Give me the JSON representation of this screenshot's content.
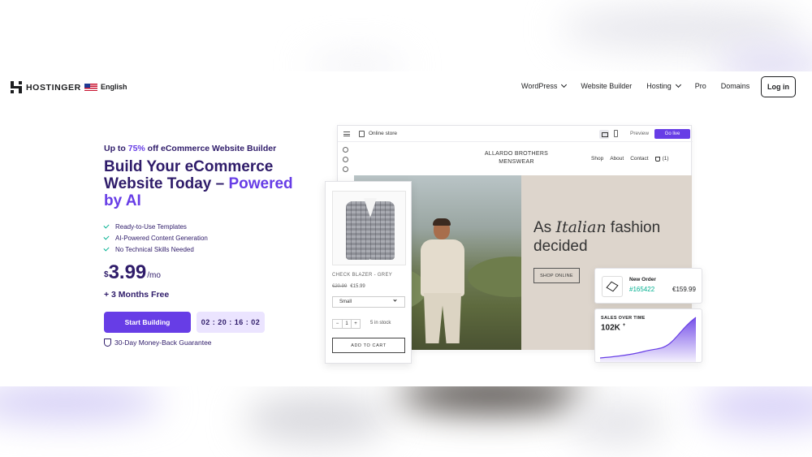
{
  "nav": {
    "logo": "HOSTINGER",
    "language": "English",
    "items": [
      {
        "label": "WordPress",
        "dropdown": true
      },
      {
        "label": "Website Builder",
        "dropdown": false
      },
      {
        "label": "Hosting",
        "dropdown": true
      },
      {
        "label": "Pro",
        "dropdown": false
      },
      {
        "label": "Domains",
        "dropdown": false
      }
    ],
    "login": "Log in"
  },
  "hero": {
    "eyebrow_prefix": "Up to ",
    "eyebrow_highlight": "75%",
    "eyebrow_suffix": " off eCommerce Website Builder",
    "headline_main": "Build Your eCommerce Website Today – ",
    "headline_highlight": "Powered by AI",
    "features": [
      "Ready-to-Use Templates",
      "AI-Powered Content Generation",
      "No Technical Skills Needed"
    ],
    "price_currency": "$",
    "price_amount": "3.99",
    "price_period": "/mo",
    "bonus": "+ 3 Months Free",
    "cta": "Start Building",
    "timer": "02 : 20 : 16 : 02",
    "guarantee": "30-Day Money-Back Guarantee"
  },
  "builder": {
    "store_label": "Online store",
    "preview": "Preview",
    "go_live": "Go live",
    "brand_line1": "ALLARDO BROTHERS",
    "brand_line2": "MENSWEAR",
    "store_nav": [
      "Shop",
      "About",
      "Contact"
    ],
    "cart": "(1)",
    "banner_as": "As ",
    "banner_italian": "Italian",
    "banner_rest": " fashion decided",
    "shop_online": "SHOP ONLINE"
  },
  "product": {
    "name": "CHECK BLAZER - GREY",
    "old_price": "€20.99",
    "price": "€15.99",
    "size": "Small",
    "qty_minus": "−",
    "qty": "1",
    "qty_plus": "+",
    "stock": "5 in stock",
    "add_to_cart": "ADD TO CART"
  },
  "order": {
    "title": "New Order",
    "id": "#165422",
    "amount": "€159.99"
  },
  "sales": {
    "title": "SALES OVER TIME",
    "value": "102K",
    "value_suffix": "+"
  },
  "colors": {
    "primary": "#673de6",
    "text_dark": "#2f1c6a",
    "success": "#00b090",
    "timer_bg": "#ebe4ff"
  }
}
